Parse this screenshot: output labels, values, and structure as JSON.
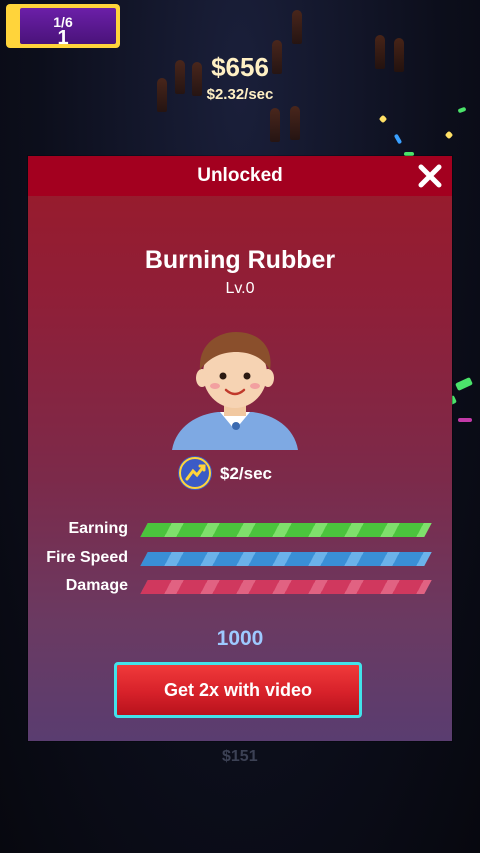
{
  "hud": {
    "level_progress": "1/6",
    "level_number": "1",
    "money": "$656",
    "rate": "$2.32/sec"
  },
  "dialog": {
    "title": "Unlocked",
    "close_icon": "close-icon",
    "hero_name": "Burning Rubber",
    "hero_level": "Lv.0",
    "income": "$2/sec",
    "stats": [
      {
        "label": "Earning",
        "color": "#4bc43d"
      },
      {
        "label": "Fire Speed",
        "color": "#3a8fd6"
      },
      {
        "label": "Damage",
        "color": "#d0385e"
      }
    ],
    "cost": "1000",
    "video_button": "Get 2x with video"
  },
  "background": {
    "price": "$151"
  },
  "colors": {
    "header": "#a3001f",
    "button_border": "#41e3ea",
    "button_fill": "#d7212a",
    "badge_gold": "#ffd43b",
    "badge_purple": "#6b1fa8"
  }
}
